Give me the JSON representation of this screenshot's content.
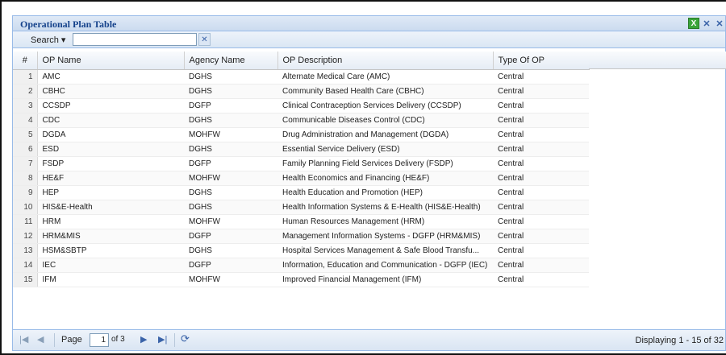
{
  "panel": {
    "title": "Operational Plan Table",
    "tools": {
      "excel": "X",
      "close1": "✕",
      "close2": "✕"
    }
  },
  "search": {
    "menu_label": "Search ▾",
    "value": "",
    "clear": "✕"
  },
  "table": {
    "columns": [
      "#",
      "OP Name",
      "Agency Name",
      "OP Description",
      "Type Of OP"
    ],
    "rows": [
      [
        "1",
        "AMC",
        "DGHS",
        "Alternate Medical Care (AMC)",
        "Central"
      ],
      [
        "2",
        "CBHC",
        "DGHS",
        "Community Based Health Care (CBHC)",
        "Central"
      ],
      [
        "3",
        "CCSDP",
        "DGFP",
        "Clinical Contraception Services Delivery (CCSDP)",
        "Central"
      ],
      [
        "4",
        "CDC",
        "DGHS",
        "Communicable Diseases Control (CDC)",
        "Central"
      ],
      [
        "5",
        "DGDA",
        "MOHFW",
        "Drug Administration and Management (DGDA)",
        "Central"
      ],
      [
        "6",
        "ESD",
        "DGHS",
        "Essential Service Delivery (ESD)",
        "Central"
      ],
      [
        "7",
        "FSDP",
        "DGFP",
        "Family Planning Field Services Delivery (FSDP)",
        "Central"
      ],
      [
        "8",
        "HE&F",
        "MOHFW",
        "Health Economics and Financing (HE&F)",
        "Central"
      ],
      [
        "9",
        "HEP",
        "DGHS",
        "Health Education and Promotion (HEP)",
        "Central"
      ],
      [
        "10",
        "HIS&E-Health",
        "DGHS",
        "Health Information Systems & E-Health (HIS&E-Health)",
        "Central"
      ],
      [
        "11",
        "HRM",
        "MOHFW",
        "Human Resources Management (HRM)",
        "Central"
      ],
      [
        "12",
        "HRM&MIS",
        "DGFP",
        "Management Information Systems - DGFP (HRM&MIS)",
        "Central"
      ],
      [
        "13",
        "HSM&SBTP",
        "DGHS",
        "Hospital Services Management & Safe Blood Transfu...",
        "Central"
      ],
      [
        "14",
        "IEC",
        "DGFP",
        "Information, Education and Communication - DGFP (IEC)",
        "Central"
      ],
      [
        "15",
        "IFM",
        "MOHFW",
        "Improved Financial Management (IFM)",
        "Central"
      ]
    ]
  },
  "pager": {
    "first": "|◀",
    "prev": "◀",
    "page_label": "Page",
    "page_value": "1",
    "of_label": "of 3",
    "next": "▶",
    "last": "▶|",
    "refresh": "⟳",
    "display": "Displaying 1 - 15 of 32"
  },
  "colors": {
    "accent": "#15428b",
    "border": "#99bbe8",
    "excel": "#3aa43a"
  }
}
